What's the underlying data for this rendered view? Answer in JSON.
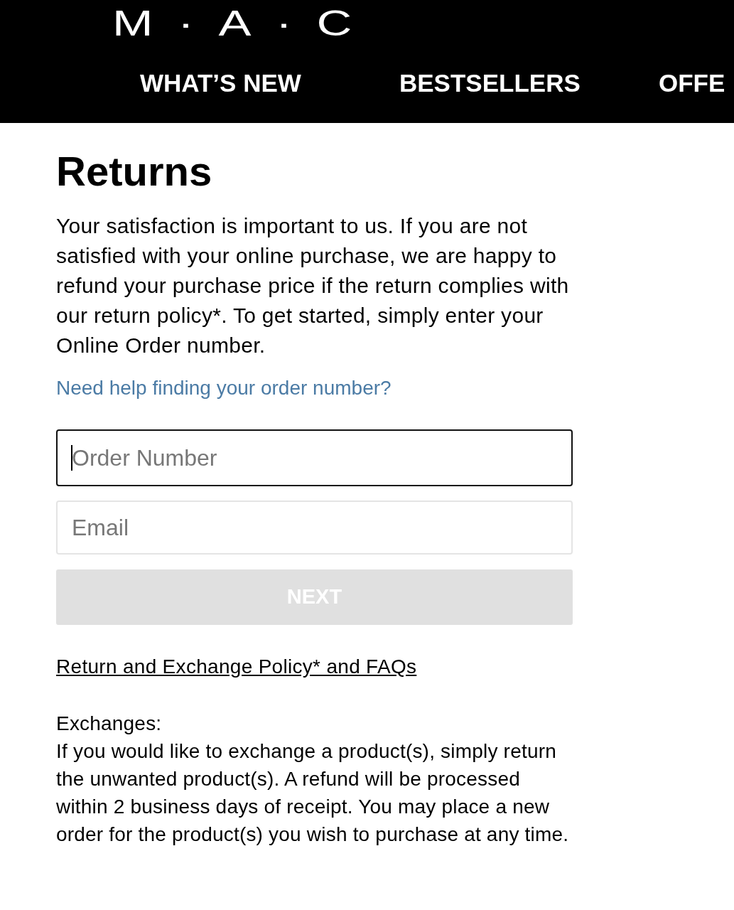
{
  "header": {
    "logo": "M·A·C",
    "nav_items": [
      "WHAT’S NEW",
      "BESTSELLERS",
      "OFFE"
    ]
  },
  "title": "Returns",
  "intro": "Your satisfaction is important to us. If you are not satisfied with your online purchase, we are happy to refund your purchase price if the return complies with our return policy*. To get started, simply enter your Online Order number.",
  "help_link": "Need help finding your order number?",
  "form": {
    "fields": [
      {
        "placeholder": "Order Number",
        "focused": true
      },
      {
        "placeholder": "Email",
        "focused": false
      }
    ],
    "next_button": {
      "label": "NEXT",
      "disabled": true
    }
  },
  "policy_link": "Return and Exchange Policy* and FAQs",
  "exchanges": {
    "title": "Exchanges:",
    "text": "If you would like to exchange a product(s), simply return the unwanted product(s). A refund will be processed within 2 business days of receipt. You may place a new order for the product(s) you wish to purchase at any time."
  }
}
